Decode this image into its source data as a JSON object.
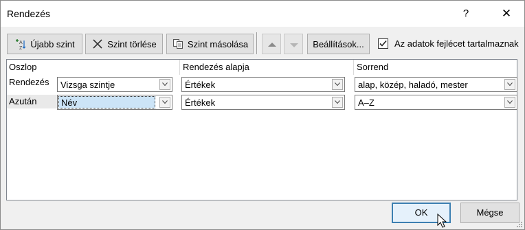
{
  "window": {
    "title": "Rendezés",
    "help": "?",
    "close": "✕"
  },
  "toolbar": {
    "add_level": "Újabb szint",
    "delete_level": "Szint törlése",
    "copy_level": "Szint másolása",
    "options": "Beállítások...",
    "header_checkbox_label": "Az adatok fejlécet tartalmaznak",
    "header_checked": true
  },
  "grid": {
    "headers": {
      "column": "Oszlop",
      "sort_on": "Rendezés alapja",
      "order": "Sorrend"
    },
    "rows": [
      {
        "label": "Rendezés",
        "column": "Vizsga szintje",
        "sort_on": "Értékek",
        "order": "alap, közép, haladó, mester"
      },
      {
        "label": "Azután",
        "column": "Név",
        "sort_on": "Értékek",
        "order": "A–Z"
      }
    ]
  },
  "footer": {
    "ok": "OK",
    "cancel": "Mégse"
  },
  "colors": {
    "selection": "#cce4f7",
    "default_button_border": "#3c7fb1"
  }
}
